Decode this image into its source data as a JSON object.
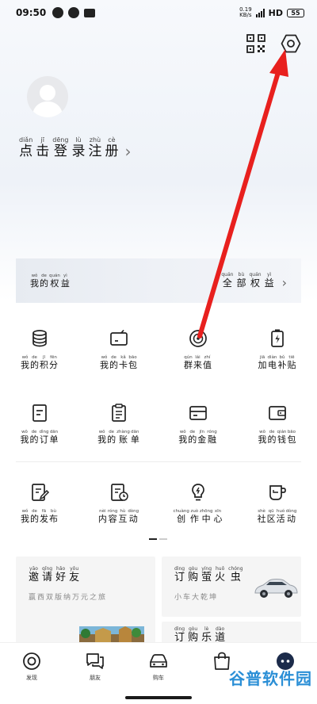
{
  "status_bar": {
    "time": "09:50",
    "net_speed_top": "0.19",
    "net_speed_bottom": "KB/s",
    "network": "HD",
    "battery": "55"
  },
  "profile": {
    "login": [
      {
        "py": "diǎn",
        "hz": "点"
      },
      {
        "py": "jī",
        "hz": "击"
      },
      {
        "py": "dēng",
        "hz": "登"
      },
      {
        "py": "lù",
        "hz": "录"
      },
      {
        "py": "zhù",
        "hz": "注"
      },
      {
        "py": "cè",
        "hz": "册"
      }
    ]
  },
  "benefits": {
    "left": [
      {
        "py": "wǒ",
        "hz": "我"
      },
      {
        "py": "de",
        "hz": "的"
      },
      {
        "py": "quán",
        "hz": "权"
      },
      {
        "py": "yì",
        "hz": "益"
      }
    ],
    "right": [
      {
        "py": "quán",
        "hz": "全"
      },
      {
        "py": "bù",
        "hz": "部"
      },
      {
        "py": "quán",
        "hz": "权"
      },
      {
        "py": "yì",
        "hz": "益"
      }
    ]
  },
  "grid": [
    [
      {
        "icon": "coins-icon",
        "chars": [
          {
            "py": "wǒ",
            "hz": "我"
          },
          {
            "py": "de",
            "hz": "的"
          },
          {
            "py": "jī",
            "hz": "积"
          },
          {
            "py": "fēn",
            "hz": "分"
          }
        ]
      },
      {
        "icon": "card-pack-icon",
        "chars": [
          {
            "py": "wǒ",
            "hz": "我"
          },
          {
            "py": "de",
            "hz": "的"
          },
          {
            "py": "kǎ",
            "hz": "卡"
          },
          {
            "py": "bāo",
            "hz": "包"
          }
        ]
      },
      {
        "icon": "community-value-icon",
        "chars": [
          {
            "py": "qún",
            "hz": "群"
          },
          {
            "py": "lái",
            "hz": "来"
          },
          {
            "py": "zhí",
            "hz": "值"
          }
        ]
      },
      {
        "icon": "charging-battery-icon",
        "chars": [
          {
            "py": "jiā",
            "hz": "加"
          },
          {
            "py": "diàn",
            "hz": "电"
          },
          {
            "py": "bǔ",
            "hz": "补"
          },
          {
            "py": "tiē",
            "hz": "贴"
          }
        ]
      }
    ],
    [
      {
        "icon": "order-icon",
        "chars": [
          {
            "py": "wǒ",
            "hz": "我"
          },
          {
            "py": "de",
            "hz": "的"
          },
          {
            "py": "dìng",
            "hz": "订"
          },
          {
            "py": "dān",
            "hz": "单"
          }
        ]
      },
      {
        "icon": "bill-icon",
        "chars": [
          {
            "py": "wǒ",
            "hz": "我"
          },
          {
            "py": "de",
            "hz": "的"
          },
          {
            "py": "zhàng",
            "hz": "账"
          },
          {
            "py": "dān",
            "hz": "单"
          }
        ]
      },
      {
        "icon": "finance-card-icon",
        "chars": [
          {
            "py": "wǒ",
            "hz": "我"
          },
          {
            "py": "de",
            "hz": "的"
          },
          {
            "py": "jīn",
            "hz": "金"
          },
          {
            "py": "róng",
            "hz": "融"
          }
        ]
      },
      {
        "icon": "wallet-icon",
        "chars": [
          {
            "py": "wǒ",
            "hz": "我"
          },
          {
            "py": "de",
            "hz": "的"
          },
          {
            "py": "qián",
            "hz": "钱"
          },
          {
            "py": "bāo",
            "hz": "包"
          }
        ]
      }
    ],
    [
      {
        "icon": "edit-post-icon",
        "chars": [
          {
            "py": "wǒ",
            "hz": "我"
          },
          {
            "py": "de",
            "hz": "的"
          },
          {
            "py": "fā",
            "hz": "发"
          },
          {
            "py": "bù",
            "hz": "布"
          }
        ]
      },
      {
        "icon": "interaction-clock-icon",
        "chars": [
          {
            "py": "nèi",
            "hz": "内"
          },
          {
            "py": "róng",
            "hz": "容"
          },
          {
            "py": "hù",
            "hz": "互"
          },
          {
            "py": "dòng",
            "hz": "动"
          }
        ]
      },
      {
        "icon": "lightbulb-icon",
        "chars": [
          {
            "py": "chuàng",
            "hz": "创"
          },
          {
            "py": "zuò",
            "hz": "作"
          },
          {
            "py": "zhōng",
            "hz": "中"
          },
          {
            "py": "xīn",
            "hz": "心"
          }
        ]
      },
      {
        "icon": "mug-icon",
        "chars": [
          {
            "py": "shè",
            "hz": "社"
          },
          {
            "py": "qū",
            "hz": "区"
          },
          {
            "py": "huó",
            "hz": "活"
          },
          {
            "py": "dòng",
            "hz": "动"
          }
        ]
      }
    ]
  ],
  "cards": {
    "invite": {
      "title": [
        {
          "py": "yāo",
          "hz": "邀"
        },
        {
          "py": "qǐng",
          "hz": "请"
        },
        {
          "py": "hǎo",
          "hz": "好"
        },
        {
          "py": "yǒu",
          "hz": "友"
        }
      ],
      "subtitle": "赢西双版纳万元之旅"
    },
    "firefly": {
      "title": [
        {
          "py": "dìng",
          "hz": "订"
        },
        {
          "py": "gòu",
          "hz": "购"
        },
        {
          "py": "yíng",
          "hz": "萤"
        },
        {
          "py": "huǒ",
          "hz": "火"
        },
        {
          "py": "chóng",
          "hz": "虫"
        }
      ],
      "subtitle": "小车大乾坤"
    },
    "ledao": {
      "title": [
        {
          "py": "dìng",
          "hz": "订"
        },
        {
          "py": "gòu",
          "hz": "购"
        },
        {
          "py": "lè",
          "hz": "乐"
        },
        {
          "py": "dào",
          "hz": "道"
        }
      ]
    }
  },
  "bottom_nav": [
    {
      "name": "discover",
      "label": "发现",
      "icon": "discover-icon"
    },
    {
      "name": "friends",
      "label": "朋友",
      "icon": "chat-bubbles-icon"
    },
    {
      "name": "buy-car",
      "label": "购车",
      "icon": "car-icon"
    },
    {
      "name": "shop",
      "label": "",
      "icon": "shopping-bag-icon"
    },
    {
      "name": "me",
      "label": "",
      "icon": "robot-face-icon"
    }
  ],
  "watermark": "谷普软件园"
}
